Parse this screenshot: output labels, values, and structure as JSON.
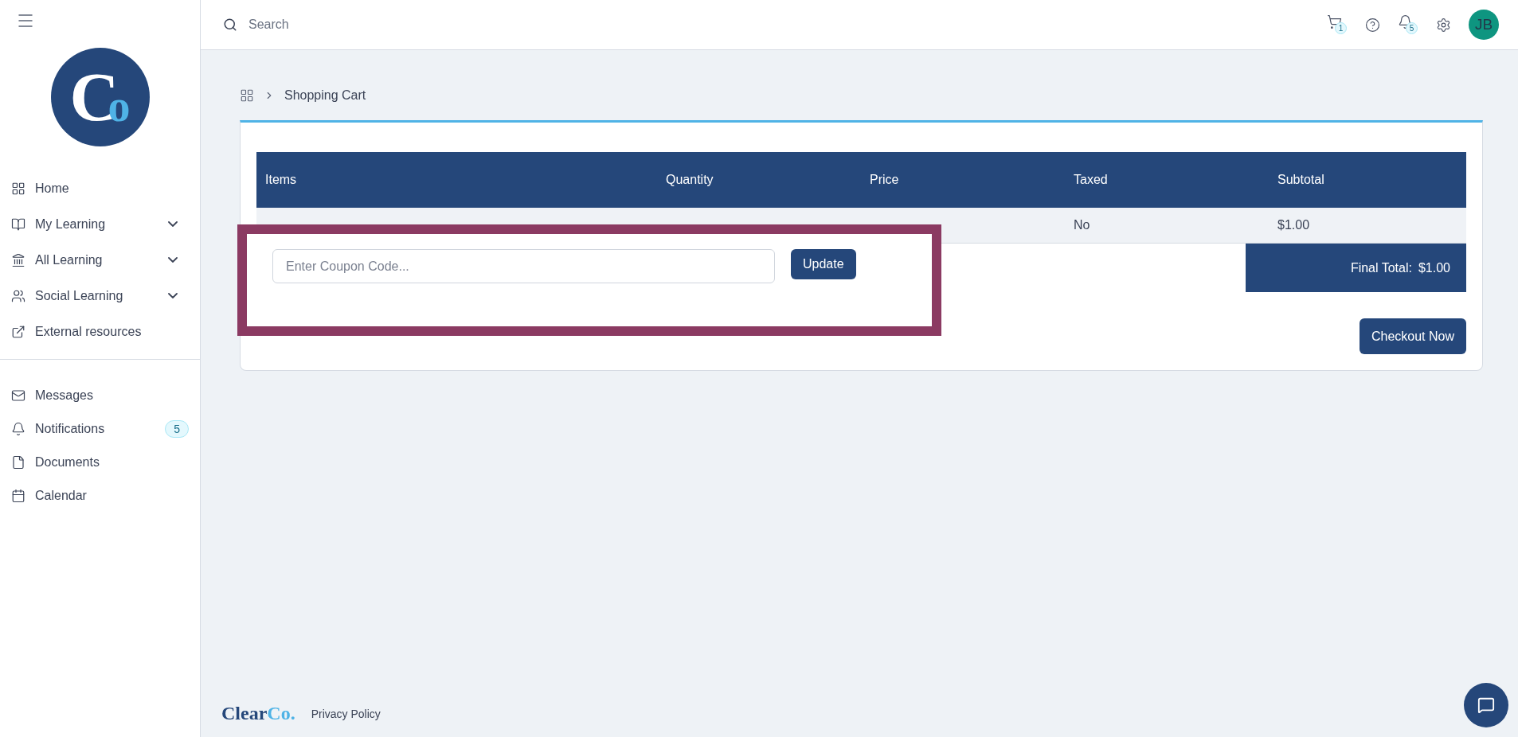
{
  "logo": {
    "letters": [
      "C",
      "o"
    ]
  },
  "nav": [
    {
      "label": "Home",
      "expandable": false
    },
    {
      "label": "My Learning",
      "expandable": true
    },
    {
      "label": "All Learning",
      "expandable": true
    },
    {
      "label": "Social Learning",
      "expandable": true
    },
    {
      "label": "External resources",
      "expandable": false
    }
  ],
  "nav_secondary": [
    {
      "label": "Messages"
    },
    {
      "label": "Notifications",
      "badge": "5"
    },
    {
      "label": "Documents"
    },
    {
      "label": "Calendar"
    }
  ],
  "topbar": {
    "search_placeholder": "Search",
    "cart_count": "1",
    "notification_count": "5",
    "avatar": "JB"
  },
  "breadcrumb": [
    "Shopping Cart"
  ],
  "table": {
    "columns": [
      "Items",
      "Quantity",
      "Price",
      "Taxed",
      "Subtotal"
    ],
    "rows": [
      {
        "taxed": "No",
        "subtotal": "$1.00"
      }
    ]
  },
  "total": {
    "label": "Final Total:",
    "value": "$1.00"
  },
  "coupon": {
    "placeholder": "Enter Coupon Code...",
    "button": "Update"
  },
  "checkout": "Checkout Now",
  "footer": {
    "brand": [
      "Clear",
      "Co."
    ],
    "link": "Privacy Policy"
  }
}
